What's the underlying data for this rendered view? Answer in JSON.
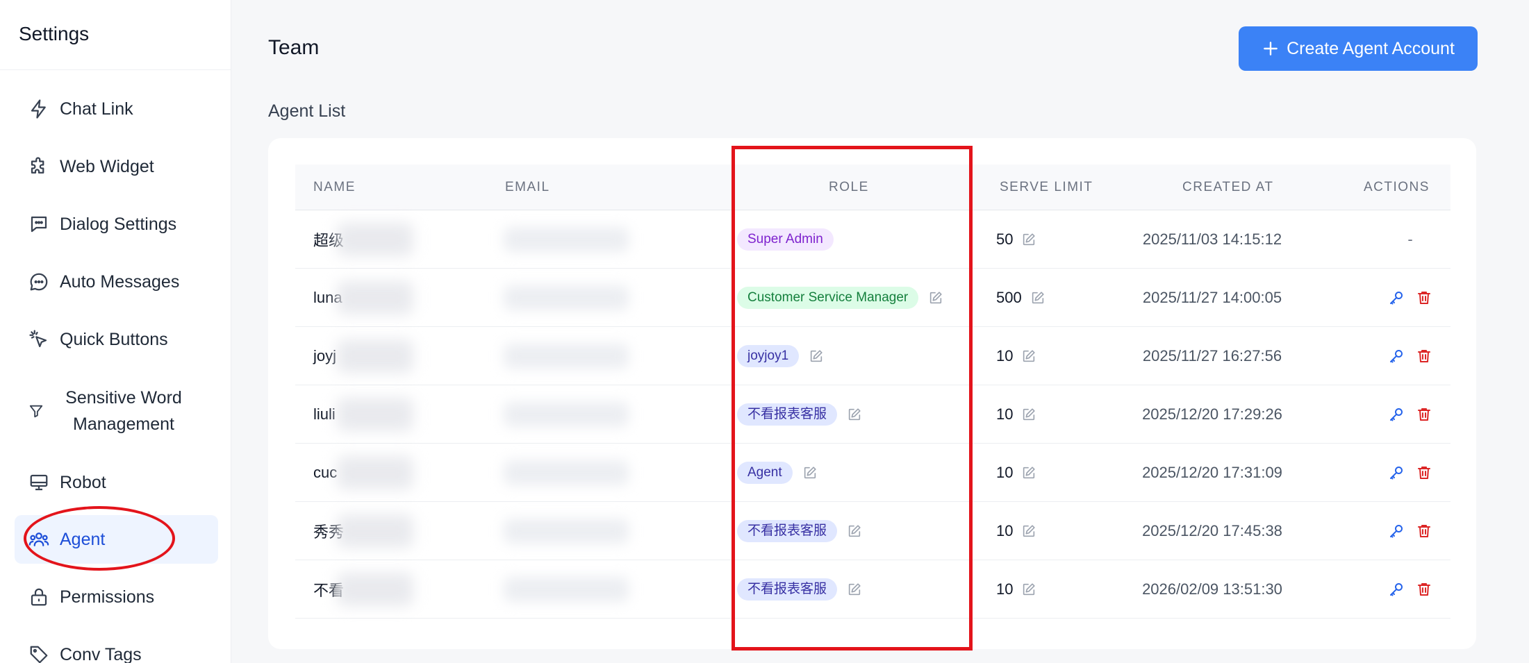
{
  "sidebar": {
    "title": "Settings",
    "items": [
      {
        "label": "Chat Link",
        "icon": "lightning-icon"
      },
      {
        "label": "Web Widget",
        "icon": "puzzle-icon"
      },
      {
        "label": "Dialog Settings",
        "icon": "message-square-icon"
      },
      {
        "label": "Auto Messages",
        "icon": "message-circle-icon"
      },
      {
        "label": "Quick Buttons",
        "icon": "cursor-click-icon"
      },
      {
        "label": "Sensitive Word Management",
        "icon": "filter-icon"
      },
      {
        "label": "Robot",
        "icon": "monitor-icon"
      },
      {
        "label": "Agent",
        "icon": "users-icon",
        "active": true
      },
      {
        "label": "Permissions",
        "icon": "lock-icon"
      },
      {
        "label": "Conv Tags",
        "icon": "tag-icon"
      }
    ]
  },
  "header": {
    "title": "Team",
    "create_button": "Create Agent Account"
  },
  "section_label": "Agent List",
  "table": {
    "columns": [
      "NAME",
      "EMAIL",
      "ROLE",
      "SERVE LIMIT",
      "CREATED AT",
      "ACTIONS"
    ],
    "rows": [
      {
        "name": "超级",
        "role": "Super Admin",
        "role_color": "purple",
        "role_editable": false,
        "serve_limit": "50",
        "created_at": "2025/11/03 14:15:12",
        "actions": "-"
      },
      {
        "name": "luna",
        "role": "Customer Service Manager",
        "role_color": "green",
        "role_editable": true,
        "serve_limit": "500",
        "created_at": "2025/11/27 14:00:05",
        "actions": "buttons"
      },
      {
        "name": "joyj",
        "role": "joyjoy1",
        "role_color": "blue",
        "role_editable": true,
        "serve_limit": "10",
        "created_at": "2025/11/27 16:27:56",
        "actions": "buttons"
      },
      {
        "name": "liuli",
        "role": "不看报表客服",
        "role_color": "blue",
        "role_editable": true,
        "serve_limit": "10",
        "created_at": "2025/12/20 17:29:26",
        "actions": "buttons"
      },
      {
        "name": "cuc",
        "role": "Agent",
        "role_color": "blue",
        "role_editable": true,
        "serve_limit": "10",
        "created_at": "2025/12/20 17:31:09",
        "actions": "buttons"
      },
      {
        "name": "秀秀",
        "role": "不看报表客服",
        "role_color": "blue",
        "role_editable": true,
        "serve_limit": "10",
        "created_at": "2025/12/20 17:45:38",
        "actions": "buttons"
      },
      {
        "name": "不看",
        "role": "不看报表客服",
        "role_color": "blue",
        "role_editable": true,
        "serve_limit": "10",
        "created_at": "2026/02/09 13:51:30",
        "actions": "buttons"
      }
    ]
  },
  "colors": {
    "accent": "#3b82f6",
    "active_nav_bg": "#eef4ff",
    "highlight_red": "#e3141b",
    "delete_red": "#dc2626"
  }
}
